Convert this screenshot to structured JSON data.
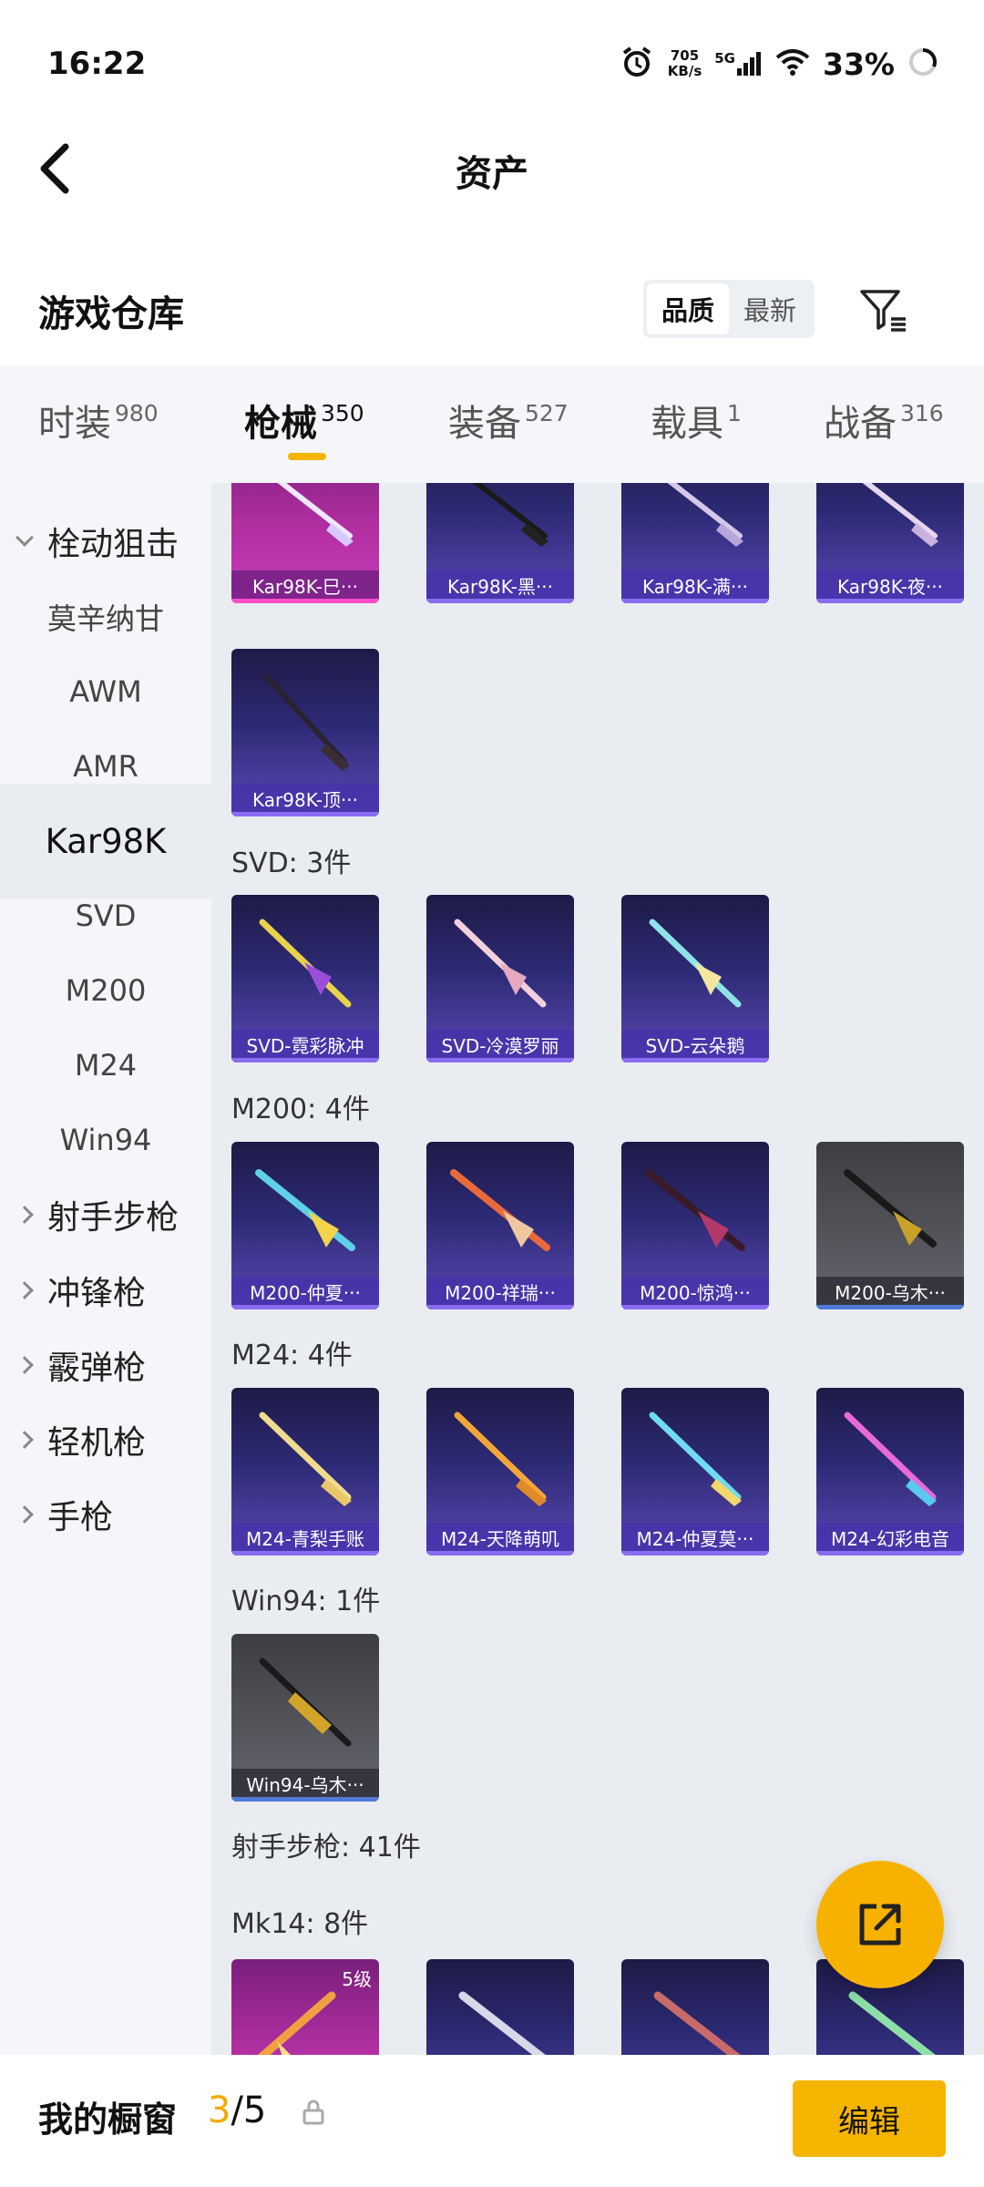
{
  "status_bar": {
    "time": "16:22",
    "net_speed_value": "705",
    "net_speed_unit": "KB/s",
    "signal": "5G",
    "battery": "33%"
  },
  "header": {
    "title": "资产"
  },
  "warehouse": {
    "title": "游戏仓库",
    "sort_options": [
      "品质",
      "最新"
    ],
    "sort_selected": "品质"
  },
  "tabs": [
    {
      "label": "时装",
      "count": "980"
    },
    {
      "label": "枪械",
      "count": "350"
    },
    {
      "label": "装备",
      "count": "527"
    },
    {
      "label": "载具",
      "count": "1"
    },
    {
      "label": "战备",
      "count": "316"
    }
  ],
  "active_tab": "枪械",
  "sidebar": {
    "items": [
      {
        "label": "栓动狙击",
        "type": "category",
        "expanded": true
      },
      {
        "label": "莫辛纳甘",
        "type": "sub"
      },
      {
        "label": "AWM",
        "type": "sub"
      },
      {
        "label": "AMR",
        "type": "sub"
      },
      {
        "label": "Kar98K",
        "type": "sub",
        "selected": true
      },
      {
        "label": "SVD",
        "type": "sub"
      },
      {
        "label": "M200",
        "type": "sub"
      },
      {
        "label": "M24",
        "type": "sub"
      },
      {
        "label": "Win94",
        "type": "sub"
      },
      {
        "label": "射手步枪",
        "type": "category",
        "expanded": false
      },
      {
        "label": "冲锋枪",
        "type": "category",
        "expanded": false
      },
      {
        "label": "霰弹枪",
        "type": "category",
        "expanded": false
      },
      {
        "label": "轻机枪",
        "type": "category",
        "expanded": false
      },
      {
        "label": "手枪",
        "type": "category",
        "expanded": false
      }
    ]
  },
  "groups": {
    "svd": "SVD: 3件",
    "m200": "M200: 4件",
    "m24": "M24: 4件",
    "win94": "Win94: 1件",
    "marksman": "射手步枪: 41件",
    "mk14": "Mk14: 8件"
  },
  "items": {
    "kar_row1": [
      "Kar98K-巳···",
      "Kar98K-黑···",
      "Kar98K-满···",
      "Kar98K-夜···"
    ],
    "kar_row2": [
      "Kar98K-顶···"
    ],
    "svd": [
      "SVD-霓彩脉冲",
      "SVD-冷漠罗丽",
      "SVD-云朵鹅"
    ],
    "m200": [
      "M200-仲夏···",
      "M200-祥瑞···",
      "M200-惊鸿···",
      "M200-乌木···"
    ],
    "m24": [
      "M24-青梨手账",
      "M24-天降萌叽",
      "M24-仲夏莫···",
      "M24-幻彩电音"
    ],
    "win94": [
      "Win94-乌木···"
    ],
    "mk14_level_badge": "5级"
  },
  "showcase": {
    "title": "我的橱窗",
    "current": "3",
    "total": "/5",
    "edit_label": "编辑"
  },
  "colors": {
    "accent": "#f5b400",
    "purple_tile": "#5c49b6",
    "pink_tile": "#b22fa2",
    "gray_tile": "#55565c"
  },
  "icons": [
    "back-arrow-icon",
    "alarm-icon",
    "signal-icon",
    "wifi-icon",
    "battery-icon",
    "filter-icon",
    "share-icon",
    "lock-icon"
  ]
}
